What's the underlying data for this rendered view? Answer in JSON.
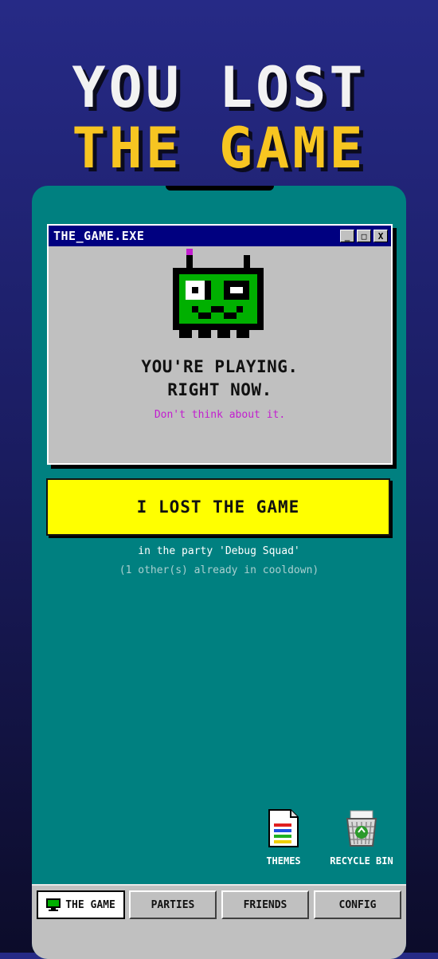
{
  "headline": {
    "line1": "YOU LOST",
    "line2": "THE GAME"
  },
  "window": {
    "title": "THE_GAME.EXE",
    "buttons": [
      "_",
      "□",
      "X"
    ],
    "message_line1": "YOU'RE PLAYING.",
    "message_line2": "RIGHT NOW.",
    "subtext": "Don't think about it."
  },
  "action": {
    "label": "I LOST THE GAME"
  },
  "party_info": "in the party 'Debug Squad'",
  "cooldown_info": "(1 other(s) already in cooldown)",
  "desktop_icons": [
    {
      "label": "THEMES",
      "icon": "document-icon"
    },
    {
      "label": "RECYCLE BIN",
      "icon": "recycle-bin-icon"
    }
  ],
  "taskbar": [
    {
      "label": "THE GAME",
      "icon": "monitor-icon",
      "active": true
    },
    {
      "label": "PARTIES"
    },
    {
      "label": "FRIENDS"
    },
    {
      "label": "CONFIG"
    }
  ],
  "colors": {
    "background_top": "#262a86",
    "phone_bg": "#008080",
    "titlebar": "#000080",
    "accent_yellow": "#ffff00",
    "headline_yellow": "#f7c521",
    "subtext_magenta": "#c21ecf",
    "robot_green": "#00b000"
  }
}
